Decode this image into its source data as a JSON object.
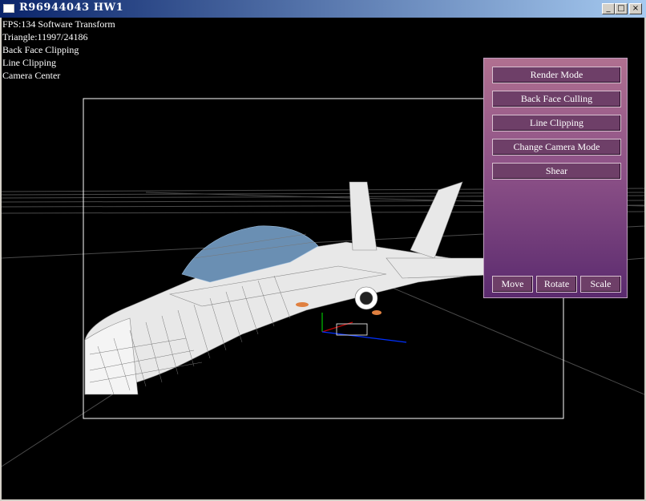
{
  "window": {
    "title": "R96944043 HW1"
  },
  "hud": {
    "fps": "FPS:134 Software Transform",
    "triangles": "Triangle:11997/24186",
    "back_face": "Back Face Clipping",
    "line_clip": "Line Clipping",
    "camera": "Camera Center"
  },
  "panel": {
    "render_mode": "Render Mode",
    "back_face_culling": "Back Face Culling",
    "line_clipping": "Line Clipping",
    "change_camera_mode": "Change Camera Mode",
    "shear": "Shear",
    "move": "Move",
    "rotate": "Rotate",
    "scale": "Scale"
  },
  "colors": {
    "titlebar_start": "#0a246a",
    "panel_top": "#b07090",
    "panel_bottom": "#5a2a6e"
  }
}
